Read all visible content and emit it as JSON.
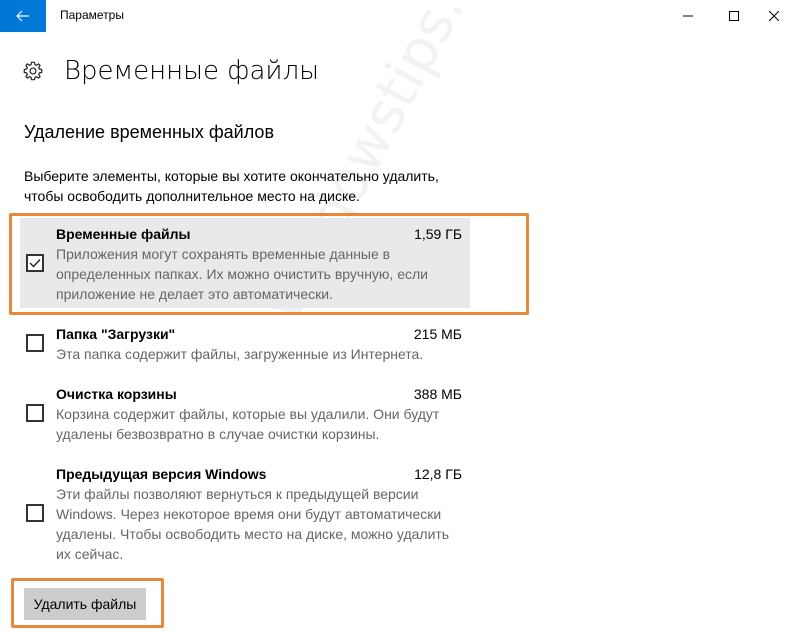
{
  "titlebar": {
    "title": "Параметры"
  },
  "header": {
    "title": "Временные файлы"
  },
  "section": {
    "title": "Удаление временных файлов",
    "description": "Выберите элементы, которые вы хотите окончательно удалить, чтобы освободить дополнительное место на диске."
  },
  "items": [
    {
      "name": "Временные файлы",
      "size": "1,59 ГБ",
      "description": "Приложения могут сохранять временные данные в определенных папках. Их можно очистить вручную, если приложение не делает это автоматически.",
      "checked": true
    },
    {
      "name": "Папка \"Загрузки\"",
      "size": "215 МБ",
      "description": "Эта папка содержит файлы, загруженные из Интернета.",
      "checked": false
    },
    {
      "name": "Очистка корзины",
      "size": "388 МБ",
      "description": "Корзина содержит файлы, которые вы удалили. Они будут удалены безвозвратно в случае очистки корзины.",
      "checked": false
    },
    {
      "name": "Предыдущая версия Windows",
      "size": "12,8 ГБ",
      "description": "Эти файлы позволяют вернуться к предыдущей версии Windows. Через некоторое время они будут автоматически удалены. Чтобы освободить место на диске, можно удалить их сейчас.",
      "checked": false
    }
  ],
  "actions": {
    "delete_label": "Удалить файлы"
  },
  "watermark": "windowstips.ru",
  "colors": {
    "accent": "#0078d7",
    "highlight": "#e8883a",
    "selected_bg": "#e9e9e9",
    "button_bg": "#cccccc"
  },
  "icons": {
    "back": "arrow-left-icon",
    "settings": "gear-icon",
    "minimize": "minimize-icon",
    "maximize": "maximize-icon",
    "close": "close-icon",
    "check": "checkmark-icon"
  }
}
